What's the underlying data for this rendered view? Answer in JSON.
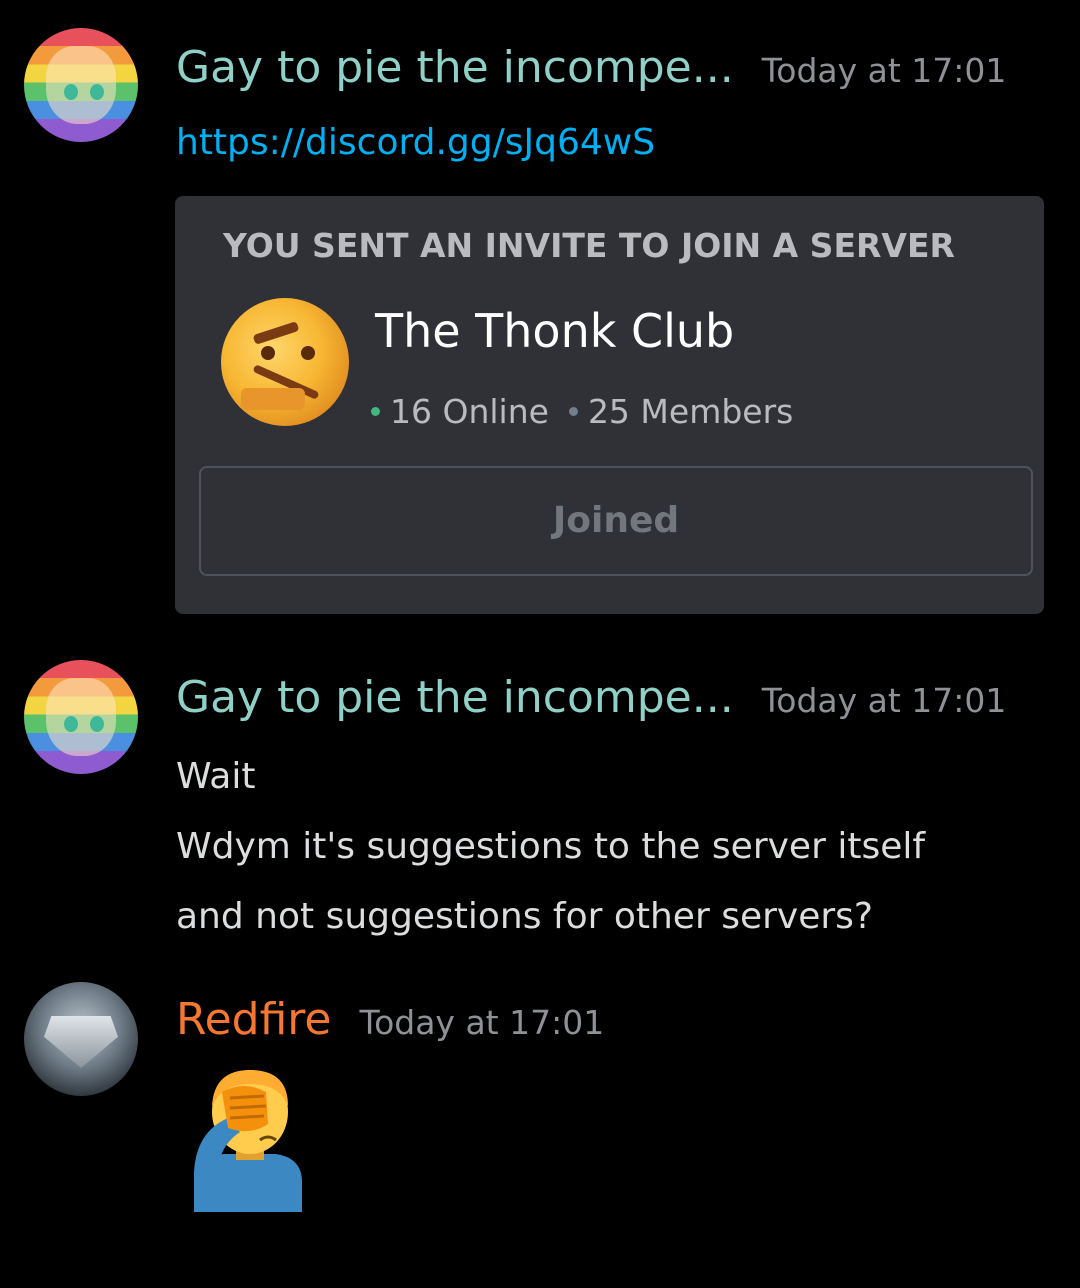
{
  "messages": [
    {
      "username": "Gay to pie the incompe...",
      "timestamp": "Today at 17:01",
      "link": "https://discord.gg/sJq64wS",
      "invite": {
        "title": "YOU SENT AN INVITE TO JOIN A SERVER",
        "server_name": "The Thonk Club",
        "online": "16 Online",
        "members": "25 Members",
        "button_label": "Joined"
      }
    },
    {
      "username": "Gay to pie the incompe...",
      "timestamp": "Today at 17:01",
      "lines": [
        "Wait",
        "Wdym it's suggestions to the server itself",
        "and not suggestions for other servers?"
      ]
    },
    {
      "username": "Redfire",
      "timestamp": "Today at 17:01",
      "emoji": "facepalm-emoji"
    }
  ],
  "colors": {
    "background": "#000000",
    "username_teal": "#8fd0c8",
    "username_orange": "#f57731",
    "link": "#00b0f4",
    "embed_bg": "#2f3136",
    "online_dot": "#43b581"
  }
}
